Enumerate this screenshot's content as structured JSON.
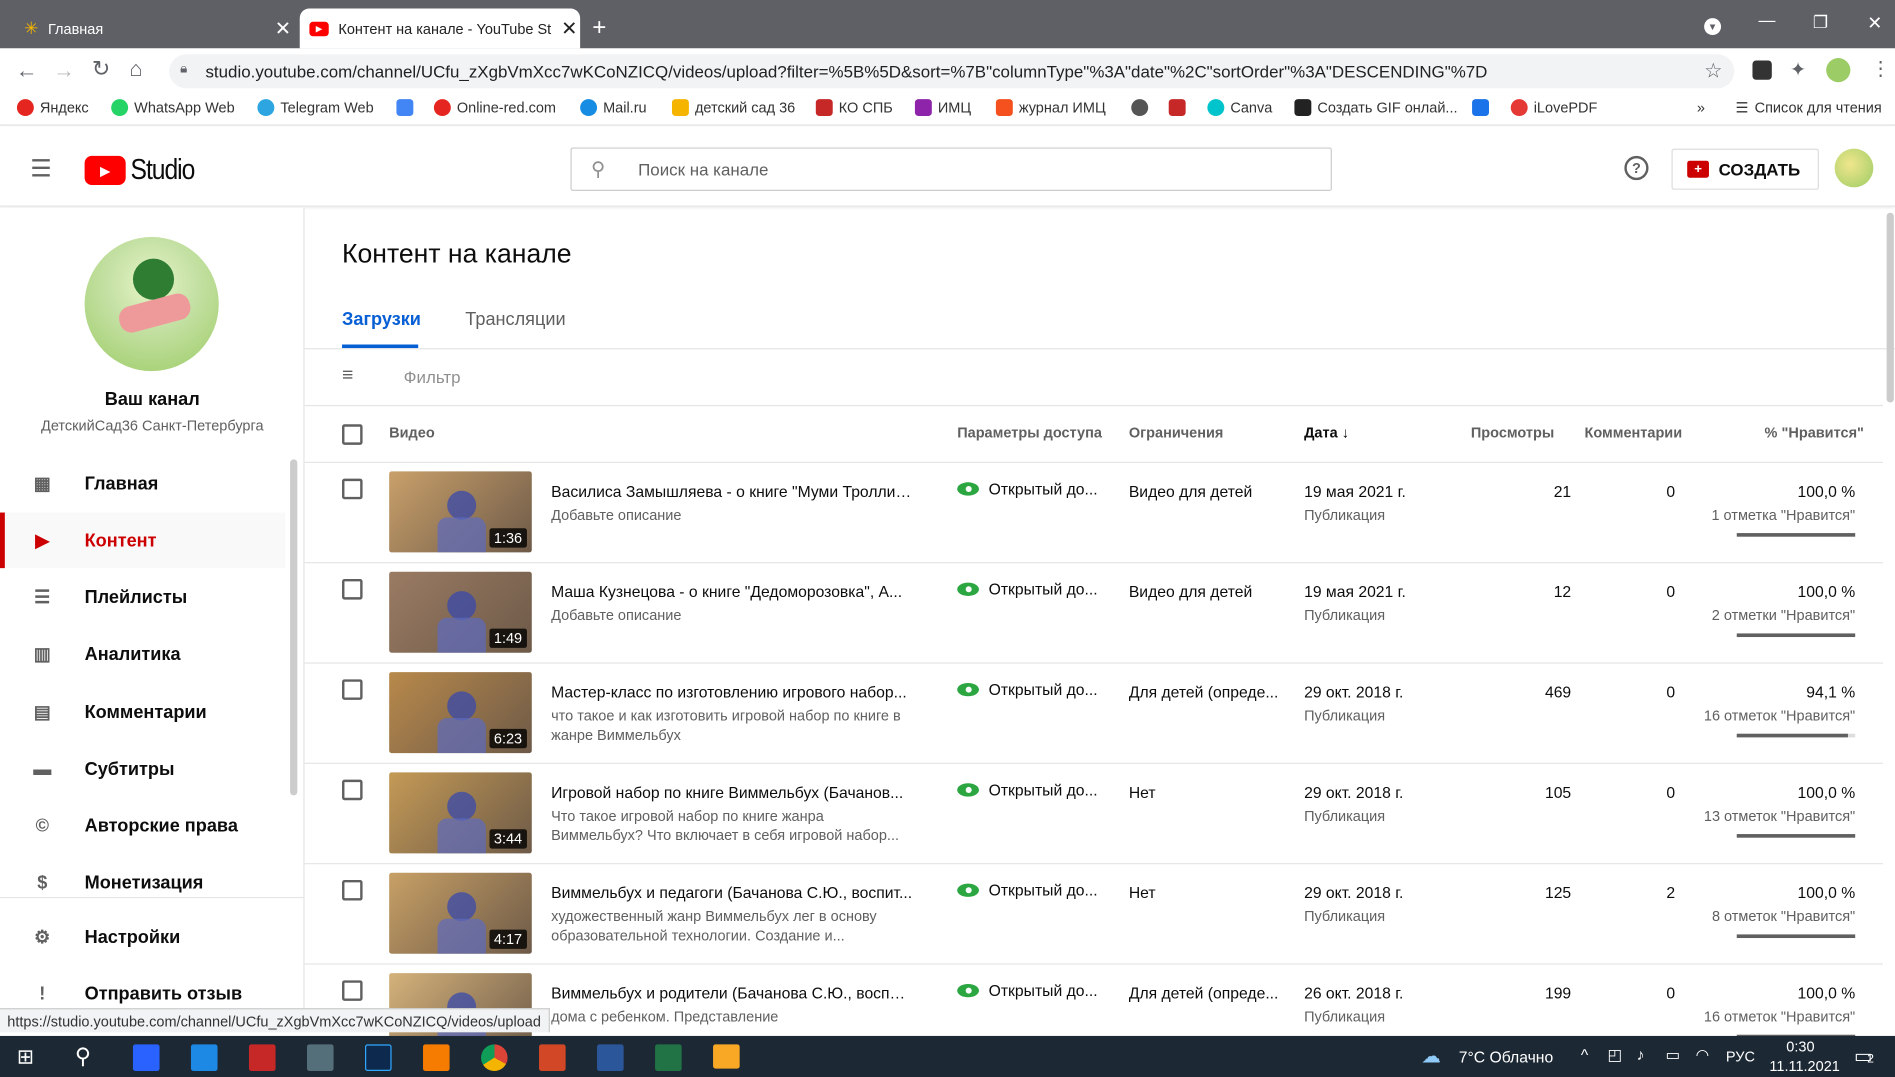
{
  "browser": {
    "tabs": [
      {
        "title": "Главная"
      },
      {
        "title": "Контент на канале - YouTube St"
      }
    ],
    "url": "studio.youtube.com/channel/UCfu_zXgbVmXcc7wKCoNZICQ/videos/upload?filter=%5B%5D&sort=%7B\"columnType\"%3A\"date\"%2C\"sortOrder\"%3A\"DESCENDING\"%7D",
    "bookmarks": [
      {
        "label": "Яндекс",
        "color": "#e52620"
      },
      {
        "label": "WhatsApp Web",
        "color": "#25d366"
      },
      {
        "label": "Telegram Web",
        "color": "#2ca5e0"
      },
      {
        "label": "",
        "color": "#4285f4"
      },
      {
        "label": "Online-red.com",
        "color": "#e52620"
      },
      {
        "label": "Mail.ru",
        "color": "#168de2"
      },
      {
        "label": "детский сад 36",
        "color": "#f4b400"
      },
      {
        "label": "КО СПБ",
        "color": "#c62828"
      },
      {
        "label": "ИМЦ",
        "color": "#8e24aa"
      },
      {
        "label": "журнал ИМЦ",
        "color": "#f4511e"
      },
      {
        "label": "",
        "color": "#555555"
      },
      {
        "label": "",
        "color": "#c62828"
      },
      {
        "label": "Canva",
        "color": "#00c4cc"
      },
      {
        "label": "Создать GIF онлай...",
        "color": "#222222"
      },
      {
        "label": "",
        "color": "#1a73e8"
      },
      {
        "label": "iLovePDF",
        "color": "#e53935"
      }
    ],
    "reading_list": "Список для чтения",
    "more": "»"
  },
  "studio": {
    "logo_text": "Studio",
    "search_placeholder": "Поиск на канале",
    "create_label": "СОЗДАТЬ"
  },
  "sidebar": {
    "channel_title": "Ваш канал",
    "channel_name": "ДетскийСад36 Санкт-Петербурга",
    "items": [
      {
        "label": "Главная",
        "icon": "dashboard-icon"
      },
      {
        "label": "Контент",
        "icon": "video-content-icon",
        "active": true
      },
      {
        "label": "Плейлисты",
        "icon": "playlist-icon"
      },
      {
        "label": "Аналитика",
        "icon": "analytics-icon"
      },
      {
        "label": "Комментарии",
        "icon": "comments-icon"
      },
      {
        "label": "Субтитры",
        "icon": "subtitles-icon"
      },
      {
        "label": "Авторские права",
        "icon": "copyright-icon"
      },
      {
        "label": "Монетизация",
        "icon": "dollar-icon"
      },
      {
        "label": "Настройки",
        "icon": "gear-icon"
      },
      {
        "label": "Отправить отзыв",
        "icon": "feedback-icon"
      }
    ]
  },
  "main": {
    "page_title": "Контент на канале",
    "tabs": [
      {
        "label": "Загрузки",
        "active": true
      },
      {
        "label": "Трансляции"
      }
    ],
    "filter_placeholder": "Фильтр",
    "columns": {
      "video": "Видео",
      "visibility": "Параметры доступа",
      "restrictions": "Ограничения",
      "date": "Дата",
      "views": "Просмотры",
      "comments": "Комментарии",
      "likes": "% \"Нравится\""
    },
    "rows": [
      {
        "title": "Василиса Замышляева - о книге \"Муми Тролли\"...",
        "desc": "Добавьте описание",
        "duration": "1:36",
        "visibility": "Открытый до...",
        "restriction": "Видео для детей",
        "date": "19 мая 2021 г.",
        "date_status": "Публикация",
        "views": "21",
        "comments": "0",
        "likes_pct": "100,0 %",
        "likes_count": "1 отметка \"Нравится\"",
        "like_ratio": 1.0,
        "thumb": "#c9a06a"
      },
      {
        "title": "Маша Кузнецова - о книге \"Дедоморозовка\", А...",
        "desc": "Добавьте описание",
        "duration": "1:49",
        "visibility": "Открытый до...",
        "restriction": "Видео для детей",
        "date": "19 мая 2021 г.",
        "date_status": "Публикация",
        "views": "12",
        "comments": "0",
        "likes_pct": "100,0 %",
        "likes_count": "2 отметки \"Нравится\"",
        "like_ratio": 1.0,
        "thumb": "#9a7b63"
      },
      {
        "title": "Мастер-класс по изготовлению игрового набор...",
        "desc": "что такое и как изготовить игровой набор по книге в жанре Виммельбух",
        "duration": "6:23",
        "visibility": "Открытый до...",
        "restriction": "Для детей (опреде...",
        "date": "29 окт. 2018 г.",
        "date_status": "Публикация",
        "views": "469",
        "comments": "0",
        "likes_pct": "94,1 %",
        "likes_count": "16 отметок \"Нравится\"",
        "like_ratio": 0.941,
        "thumb": "#b8894a"
      },
      {
        "title": "Игровой набор по книге Виммельбух (Бачанов...",
        "desc": "Что такое игровой набор по книге жанра Виммельбух? Что включает в себя игровой набор...",
        "duration": "3:44",
        "visibility": "Открытый до...",
        "restriction": "Нет",
        "date": "29 окт. 2018 г.",
        "date_status": "Публикация",
        "views": "105",
        "comments": "0",
        "likes_pct": "100,0 %",
        "likes_count": "13 отметок \"Нравится\"",
        "like_ratio": 1.0,
        "thumb": "#c49a55"
      },
      {
        "title": "Виммельбух и педагоги (Бачанова С.Ю., воспит...",
        "desc": "художественный жанр Виммельбух лег в основу образовательной технологии. Создание и...",
        "duration": "4:17",
        "visibility": "Открытый до...",
        "restriction": "Нет",
        "date": "29 окт. 2018 г.",
        "date_status": "Публикация",
        "views": "125",
        "comments": "2",
        "likes_pct": "100,0 %",
        "likes_count": "8 отметок \"Нравится\"",
        "like_ratio": 1.0,
        "thumb": "#c7a065"
      },
      {
        "title": "Виммельбух и родители (Бачанова С.Ю., воспит...",
        "desc": "дома с ребенком. Представление",
        "duration": "",
        "visibility": "Открытый до...",
        "restriction": "Для детей (опреде...",
        "date": "26 окт. 2018 г.",
        "date_status": "Публикация",
        "views": "199",
        "comments": "0",
        "likes_pct": "100,0 %",
        "likes_count": "16 отметок \"Нравится\"",
        "like_ratio": 1.0,
        "thumb": "#d4b27a"
      }
    ]
  },
  "status_url": "https://studio.youtube.com/channel/UCfu_zXgbVmXcc7wKCoNZICQ/videos/upload",
  "taskbar": {
    "weather": "7°C Облачно",
    "lang": "РУС",
    "time": "0:30",
    "date": "11.11.2021",
    "notif_count": "2"
  },
  "colors": {
    "accent": "#cc0000",
    "link_blue": "#065fd4",
    "green_eye": "#2ba640"
  }
}
